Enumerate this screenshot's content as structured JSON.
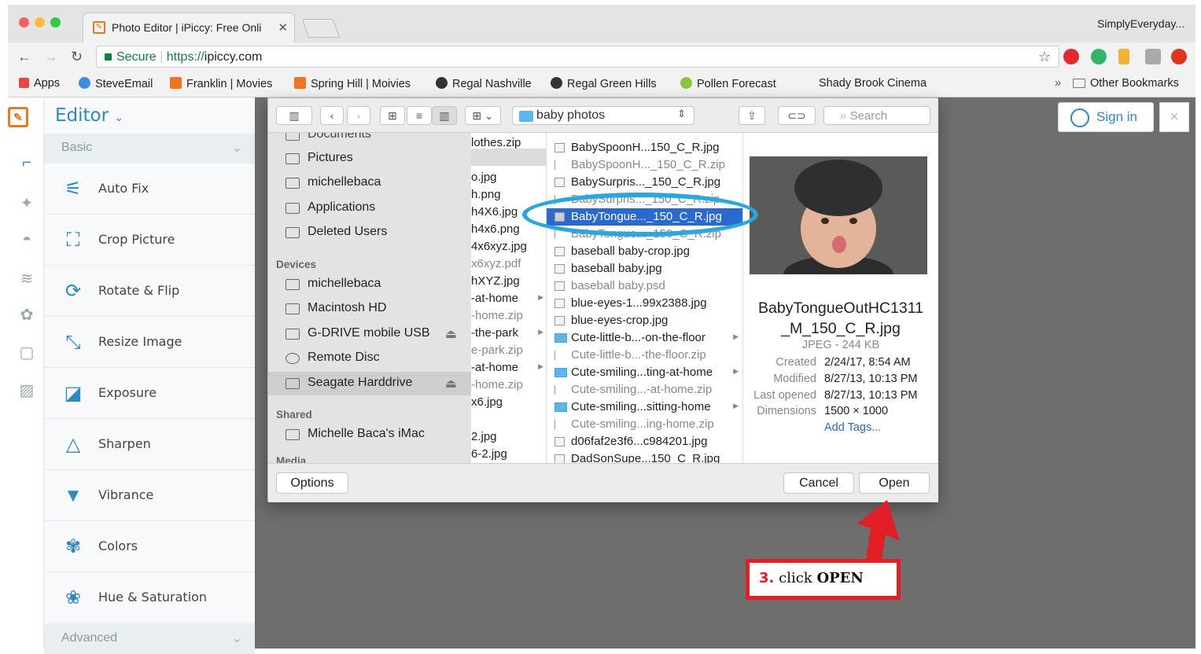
{
  "browser": {
    "tab_title": "Photo Editor | iPiccy: Free Onli",
    "profile": "SimplyEveryday...",
    "secure_label": "Secure",
    "url_scheme": "https://",
    "url_domain": "ipiccy.com",
    "bookmarks": [
      "Apps",
      "SteveEmail",
      "Franklin | Movies",
      "Spring Hill | Moivies",
      "Regal Nashville",
      "Regal Green Hills",
      "Pollen Forecast",
      "Shady Brook Cinema"
    ],
    "more": "»",
    "other_bookmarks": "Other Bookmarks"
  },
  "app": {
    "editor_label": "Editor",
    "section_basic": "Basic",
    "section_advanced": "Advanced",
    "tools": [
      "Auto Fix",
      "Crop Picture",
      "Rotate & Flip",
      "Resize Image",
      "Exposure",
      "Sharpen",
      "Vibrance",
      "Colors",
      "Hue & Saturation"
    ],
    "sign_in": "Sign in",
    "close": "×"
  },
  "dialog": {
    "path": "baby photos",
    "search_placeholder": "Search",
    "sidebar": {
      "top_cut": "Documents",
      "favorites": [
        "Pictures",
        "michellebaca",
        "Applications",
        "Deleted Users"
      ],
      "devices_header": "Devices",
      "devices": [
        "michellebaca",
        "Macintosh HD",
        "G-DRIVE mobile USB",
        "Remote Disc",
        "Seagate Harddrive"
      ],
      "shared_header": "Shared",
      "shared": [
        "Michelle Baca's iMac"
      ],
      "bottom_cut": "Media"
    },
    "column1": [
      "lothes.zip",
      "",
      "o.jpg",
      "h.png",
      "h4X6.jpg",
      "h4x6.png",
      "4x6xyz.jpg",
      "x6xyz.pdf",
      "hXYZ.jpg",
      "-at-home",
      "-home.zip",
      "-the-park",
      "e-park.zip",
      "-at-home",
      "-home.zip",
      "x6.jpg",
      "",
      "2.jpg",
      "6-2.jpg"
    ],
    "column2": [
      "BabySpoonH...150_C_R.jpg",
      "BabySpoonH..._150_C_R.zip",
      "BabySurpris..._150_C_R.jpg",
      "BabySurpris..._150_C_R.zip",
      "BabyTongue..._150_C_R.jpg",
      "BabyTongue..._150_C_R.zip",
      "baseball baby-crop.jpg",
      "baseball baby.jpg",
      "baseball baby.psd",
      "blue-eyes-1...99x2388.jpg",
      "blue-eyes-crop.jpg",
      "Cute-little-b...-on-the-floor",
      "Cute-little-b...-the-floor.zip",
      "Cute-smiling...ting-at-home",
      "Cute-smiling...-at-home.zip",
      "Cute-smiling...sitting-home",
      "Cute-smiling...ing-home.zip",
      "d06faf2e3f6...c984201.jpg",
      "DadSonSupe...150_C_R.jpg"
    ],
    "preview": {
      "name_line1": "BabyTongueOutHC1311",
      "name_line2": "_M_150_C_R.jpg",
      "kind": "JPEG - 244 KB",
      "created_label": "Created",
      "created": "2/24/17, 8:54 AM",
      "modified_label": "Modified",
      "modified": "8/27/13, 10:13 PM",
      "opened_label": "Last opened",
      "opened": "8/27/13, 10:13 PM",
      "dims_label": "Dimensions",
      "dims": "1500 × 1000",
      "add_tags": "Add Tags..."
    },
    "options": "Options",
    "cancel": "Cancel",
    "open": "Open"
  },
  "annotation": {
    "step": "3.",
    "text": "click",
    "bold": "OPEN"
  },
  "colors": {
    "accent": "#2b8ac4",
    "selection": "#2a6ad0",
    "annotation_red": "#e21e26",
    "annotation_blue": "#2aa7dd"
  }
}
